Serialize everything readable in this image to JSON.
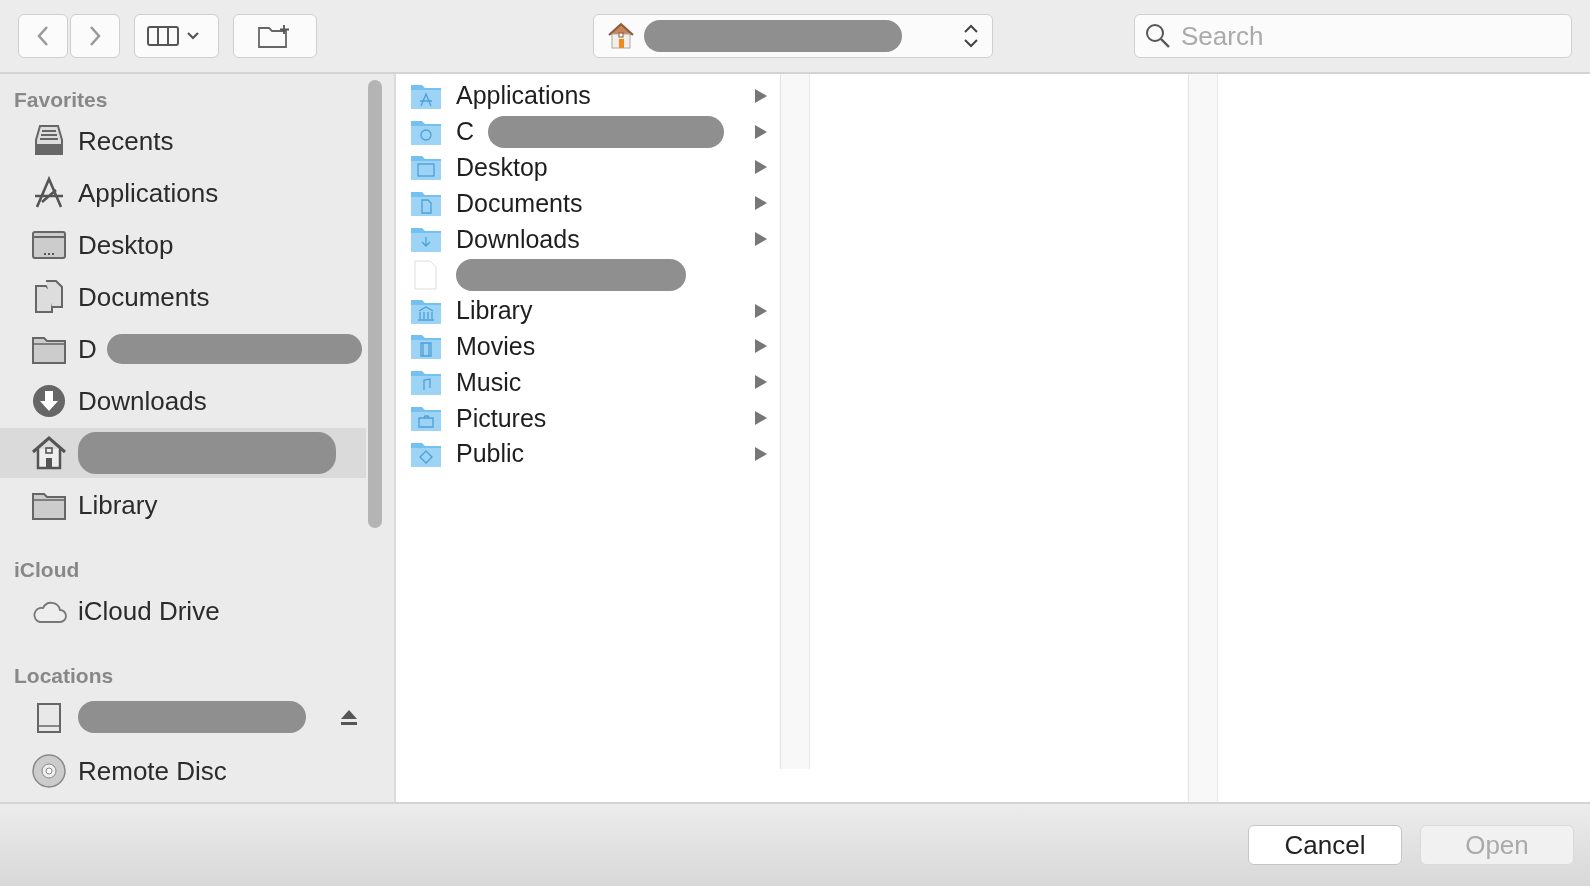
{
  "toolbar": {
    "search": {
      "placeholder": "Search"
    },
    "path": {
      "redacted": true
    }
  },
  "sidebar": {
    "sections": [
      {
        "title": "Favorites",
        "items": [
          {
            "kind": "recents",
            "label": "Recents",
            "selected": false,
            "redacted": false
          },
          {
            "kind": "applications",
            "label": "Applications",
            "selected": false,
            "redacted": false
          },
          {
            "kind": "desktop",
            "label": "Desktop",
            "selected": false,
            "redacted": false
          },
          {
            "kind": "documents",
            "label": "Documents",
            "selected": false,
            "redacted": false
          },
          {
            "kind": "folder",
            "label": "D",
            "selected": false,
            "redacted": true
          },
          {
            "kind": "downloads",
            "label": "Downloads",
            "selected": false,
            "redacted": false
          },
          {
            "kind": "home",
            "selected": true,
            "redacted": true
          },
          {
            "kind": "folder",
            "label": "Library",
            "selected": false,
            "redacted": false
          }
        ]
      },
      {
        "title": "iCloud",
        "items": [
          {
            "kind": "cloud",
            "label": "iCloud Drive",
            "selected": false,
            "redacted": false
          }
        ]
      },
      {
        "title": "Locations",
        "items": [
          {
            "kind": "drive",
            "selected": false,
            "redacted": true,
            "ejectable": true
          },
          {
            "kind": "disc",
            "label": "Remote Disc",
            "selected": false,
            "redacted": false
          }
        ]
      }
    ]
  },
  "column": {
    "rows": [
      {
        "kind": "applications",
        "label": "Applications",
        "expandable": true,
        "redacted": false
      },
      {
        "kind": "cloud",
        "label": "C",
        "expandable": true,
        "redacted": true
      },
      {
        "kind": "desktop",
        "label": "Desktop",
        "expandable": true,
        "redacted": false
      },
      {
        "kind": "documents",
        "label": "Documents",
        "expandable": true,
        "redacted": false
      },
      {
        "kind": "downloads",
        "label": "Downloads",
        "expandable": true,
        "redacted": false
      },
      {
        "kind": "file",
        "expandable": false,
        "redacted": true
      },
      {
        "kind": "library",
        "label": "Library",
        "expandable": true,
        "redacted": false
      },
      {
        "kind": "movies",
        "label": "Movies",
        "expandable": true,
        "redacted": false
      },
      {
        "kind": "music",
        "label": "Music",
        "expandable": true,
        "redacted": false
      },
      {
        "kind": "pictures",
        "label": "Pictures",
        "expandable": true,
        "redacted": false
      },
      {
        "kind": "public",
        "label": "Public",
        "expandable": true,
        "redacted": false
      }
    ]
  },
  "buttons": [
    {
      "label": "Cancel",
      "disabled": false
    },
    {
      "label": "Open",
      "disabled": true
    }
  ]
}
